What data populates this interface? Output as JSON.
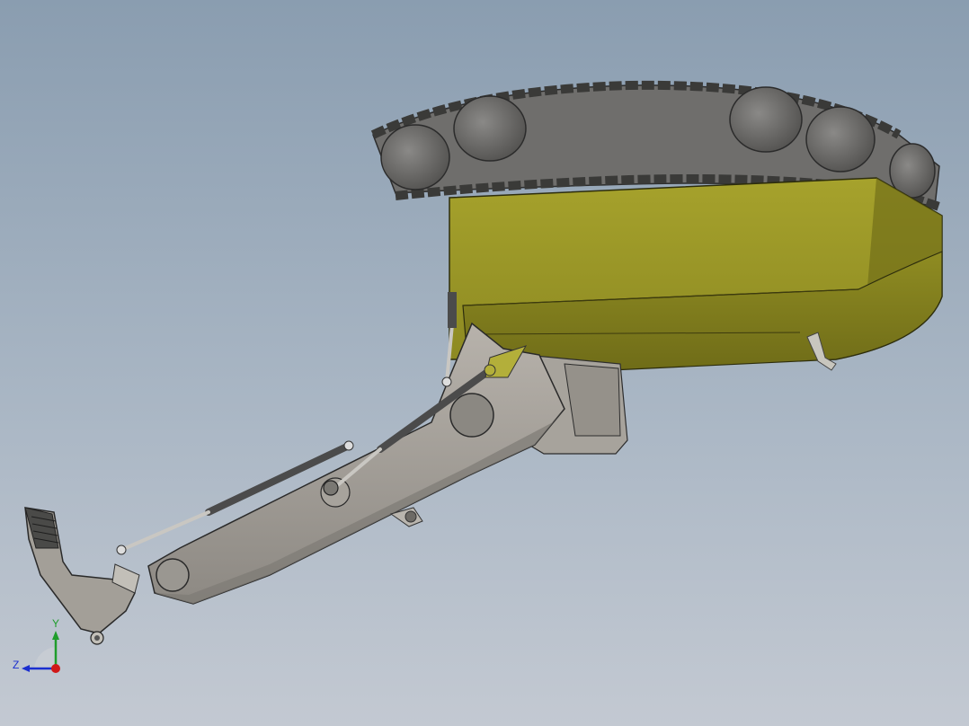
{
  "viewport": {
    "background_top": "#8a9db0",
    "background_bottom": "#c3c9d2"
  },
  "model": {
    "name": "tracked-excavator-assembly",
    "body_color": "#9c9a2a",
    "arm_color": "#a39f99",
    "track_color": "#6e6d6b",
    "cylinder_color": "#4a4a4a"
  },
  "triad": {
    "y_label": "Y",
    "z_label": "Z",
    "y_color": "#1f9d2b",
    "z_color": "#1b2fcf",
    "x_color": "#d01818"
  }
}
